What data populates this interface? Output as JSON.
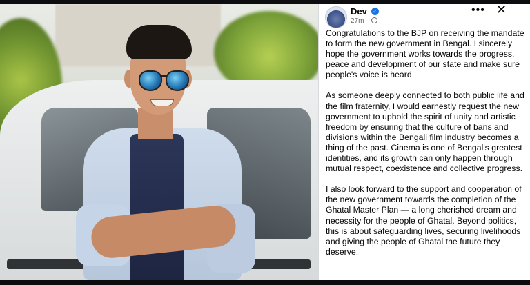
{
  "post": {
    "author": "Dev",
    "time": "27m",
    "more_label": "•••",
    "close_label": "✕",
    "verified_mark": "✓",
    "paragraphs": [
      "Congratulations to the BJP on receiving the mandate to form the new government in Bengal. I sincerely hope the government works towards the progress, peace and development of our state and make sure people's voice is heard.",
      "As someone deeply connected to both public life and the film fraternity, I would earnestly request the new government to uphold the spirit of unity and artistic freedom by ensuring that the culture of bans and divisions within the Bengali film industry becomes a thing of the past. Cinema is one of Bengal's greatest identities, and its growth can only happen through mutual respect, coexistence and collective progress.",
      "I also look forward to the support and cooperation of the new government towards the completion of the Ghatal Master Plan — a long cherished dream and necessity for the people of Ghatal. Beyond politics, this is about safeguarding lives, securing livelihoods and giving the people of Ghatal the future they deserve."
    ]
  },
  "icons": {
    "verified": "verified-badge-icon",
    "audience": "globe-icon",
    "more": "more-options-icon",
    "close": "close-icon"
  },
  "colors": {
    "verified_blue": "#1b74e4",
    "meta_gray": "#65676b",
    "text": "#050505"
  }
}
